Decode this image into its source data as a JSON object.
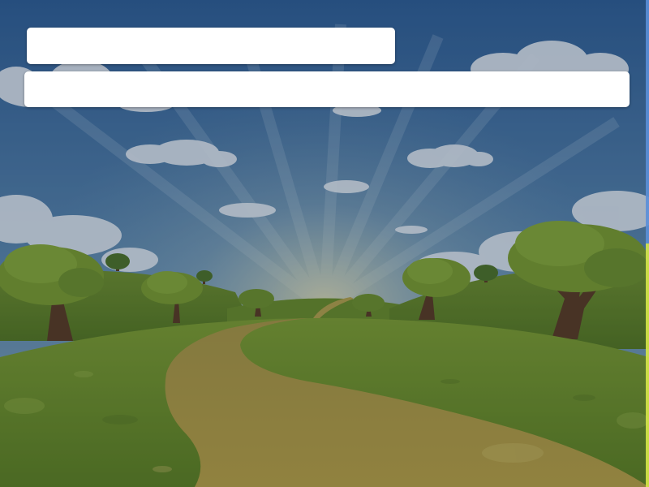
{
  "scene": {
    "description_icon": "park-landscape-illustration",
    "colors": {
      "sky_top": "#2f5d94",
      "sky_bottom": "#6d94b6",
      "grass": "#7a9a2e",
      "path": "#b5a24a",
      "foliage": "#6f8f2a",
      "trunk": "#5a3a22"
    }
  },
  "bars": {
    "top_text": "",
    "wide_text": ""
  }
}
